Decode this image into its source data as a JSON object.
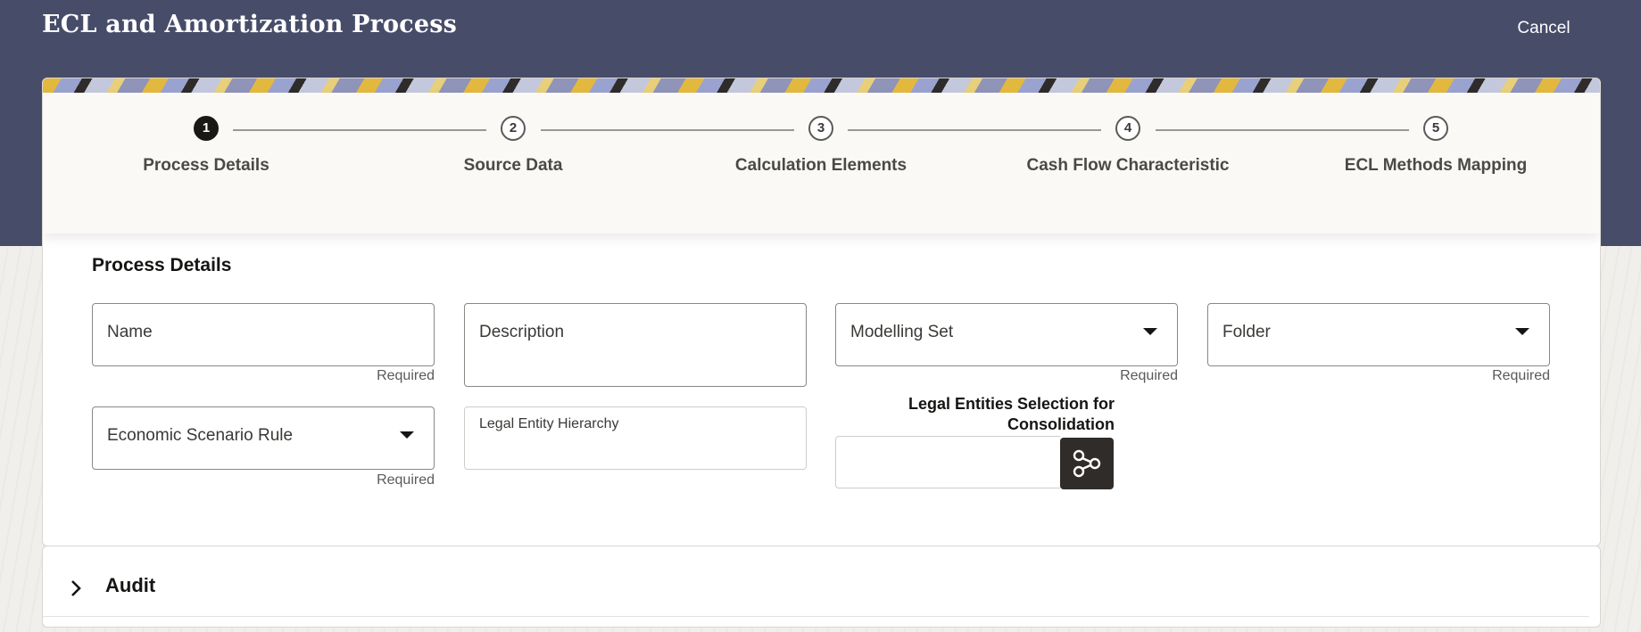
{
  "header": {
    "title": "ECL and Amortization Process",
    "cancel_label": "Cancel"
  },
  "train": {
    "steps": [
      {
        "number": "1",
        "label": "Process Details",
        "active": true
      },
      {
        "number": "2",
        "label": "Source Data",
        "active": false
      },
      {
        "number": "3",
        "label": "Calculation Elements",
        "active": false
      },
      {
        "number": "4",
        "label": "Cash Flow Characteristic",
        "active": false
      },
      {
        "number": "5",
        "label": "ECL Methods Mapping",
        "active": false
      }
    ]
  },
  "form": {
    "section_title": "Process Details",
    "name_label": "Name",
    "description_label": "Description",
    "modelling_set_label": "Modelling Set",
    "folder_label": "Folder",
    "economic_scenario_label": "Economic Scenario Rule",
    "legal_entity_hierarchy_label": "Legal Entity Hierarchy",
    "consolidation_label": "Legal Entities Selection for Consolidation",
    "required_text": "Required"
  },
  "audit": {
    "title": "Audit"
  },
  "colors": {
    "header_bg": "#474c69",
    "active_step": "#1a1816",
    "button_dark": "#2f2c29"
  }
}
